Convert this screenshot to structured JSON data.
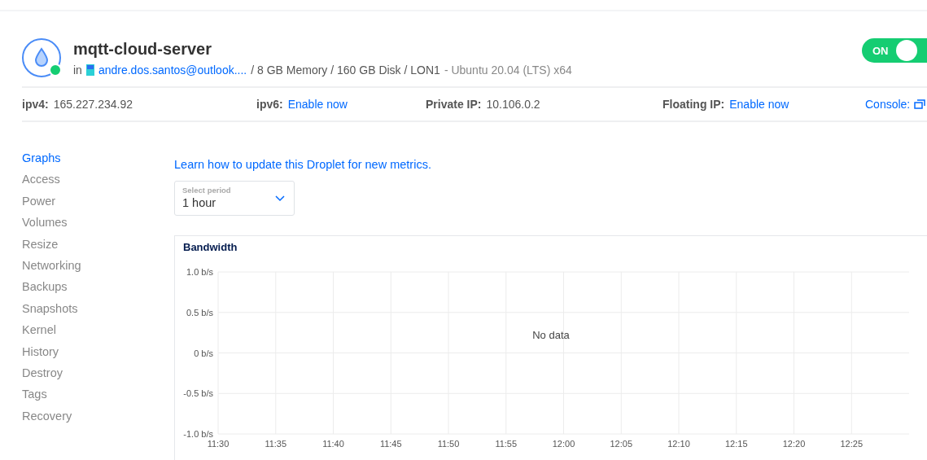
{
  "droplet": {
    "name": "mqtt-cloud-server",
    "in_label": "in",
    "owner": "andre.dos.santos@outlook....",
    "specs": "/ 8 GB Memory / 160 GB Disk / LON1",
    "os": "- Ubuntu 20.04 (LTS) x64",
    "status_online": true
  },
  "power_toggle": {
    "label": "ON",
    "on": true
  },
  "network": [
    {
      "label": "ipv4:",
      "value": "165.227.234.92",
      "kind": "text"
    },
    {
      "label": "ipv6:",
      "value": "Enable now",
      "kind": "link"
    },
    {
      "label": "Private IP:",
      "value": "10.106.0.2",
      "kind": "text"
    },
    {
      "label": "Floating IP:",
      "value": "Enable now",
      "kind": "link"
    }
  ],
  "console": {
    "label": "Console:"
  },
  "sidebar": {
    "items": [
      {
        "label": "Graphs",
        "selected": true
      },
      {
        "label": "Access",
        "selected": false
      },
      {
        "label": "Power",
        "selected": false
      },
      {
        "label": "Volumes",
        "selected": false
      },
      {
        "label": "Resize",
        "selected": false
      },
      {
        "label": "Networking",
        "selected": false
      },
      {
        "label": "Backups",
        "selected": false
      },
      {
        "label": "Snapshots",
        "selected": false
      },
      {
        "label": "Kernel",
        "selected": false
      },
      {
        "label": "History",
        "selected": false
      },
      {
        "label": "Destroy",
        "selected": false
      },
      {
        "label": "Tags",
        "selected": false
      },
      {
        "label": "Recovery",
        "selected": false
      }
    ]
  },
  "metrics_link": "Learn how to update this Droplet for new metrics.",
  "period_select": {
    "label": "Select period",
    "value": "1 hour"
  },
  "bandwidth": {
    "empty_message": "No data",
    "chart_data": {
      "type": "line",
      "title": "Bandwidth",
      "grid": true,
      "ylim": [
        -1,
        1
      ],
      "categories": [
        "11:30",
        "11:35",
        "11:40",
        "11:45",
        "11:50",
        "11:55",
        "12:00",
        "12:05",
        "12:10",
        "12:15",
        "12:20",
        "12:25"
      ],
      "yticks": [
        {
          "value": 1,
          "label": "1.0 b/s"
        },
        {
          "value": 0.5,
          "label": "0.5 b/s"
        },
        {
          "value": 0,
          "label": "0 b/s"
        },
        {
          "value": -0.5,
          "label": "-0.5 b/s"
        },
        {
          "value": -1,
          "label": "-1.0 b/s"
        }
      ]
    }
  }
}
